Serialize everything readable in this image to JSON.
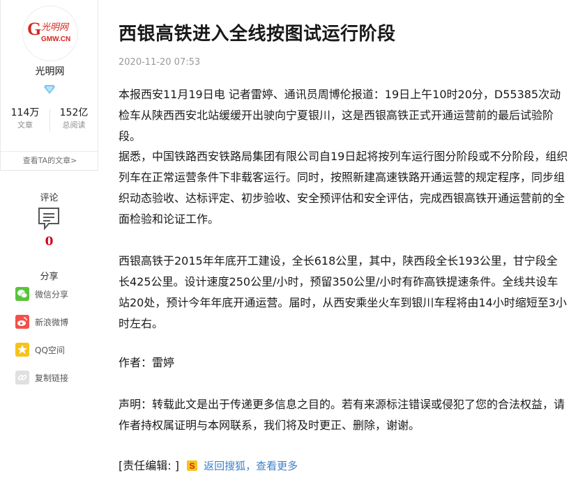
{
  "author": {
    "logo_text": "光明网",
    "logo_domain": "GMW.CN",
    "name": "光明网",
    "stats": [
      {
        "value": "114万",
        "label": "文章"
      },
      {
        "value": "152亿",
        "label": "总阅读"
      }
    ],
    "view_articles": "查看TA的文章>"
  },
  "comment": {
    "title": "评论",
    "count": "0"
  },
  "share": {
    "title": "分享",
    "items": [
      {
        "label": "微信分享",
        "icon": "wechat-icon"
      },
      {
        "label": "新浪微博",
        "icon": "weibo-icon"
      },
      {
        "label": "QQ空间",
        "icon": "qzone-icon"
      },
      {
        "label": "复制链接",
        "icon": "link-icon"
      }
    ]
  },
  "article": {
    "title": "西银高铁进入全线按图试运行阶段",
    "time": "2020-11-20 07:53",
    "paragraphs": [
      "本报西安11月19日电 记者雷婷、通讯员周博伦报道：19日上午10时20分，D55385次动检车从陕西西安北站缓缓开出驶向宁夏银川，这是西银高铁正式开通运营前的最后试验阶段。",
      "据悉，中国铁路西安铁路局集团有限公司自19日起将按列车运行图分阶段或不分阶段，组织列车在正常运营条件下非载客运行。同时，按照新建高速铁路开通运营的规定程序，同步组织动态验收、达标评定、初步验收、安全预评估和安全评估，完成西银高铁开通运营前的全面检验和论证工作。",
      "西银高铁于2015年年底开工建设，全长618公里，其中，陕西段全长193公里，甘宁段全长425公里。设计速度250公里/小时，预留350公里/小时有砟高铁提速条件。全线共设车站20处，预计今年年底开通运营。届时，从西安乘坐火车到银川车程将由14小时缩短至3小时左右。",
      "作者：雷婷",
      "声明：转载此文是出于传递更多信息之目的。若有来源标注错误或侵犯了您的合法权益，请作者持权属证明与本网联系，我们将及时更正、删除，谢谢。"
    ],
    "editor_label": "[责任编辑: ]",
    "back_link": "返回搜狐，查看更多"
  },
  "colors": {
    "logo_red": "#d7261e",
    "comment_red": "#d0021b",
    "link_blue": "#3c80c9",
    "verify_blue": "#7cc6f2"
  }
}
